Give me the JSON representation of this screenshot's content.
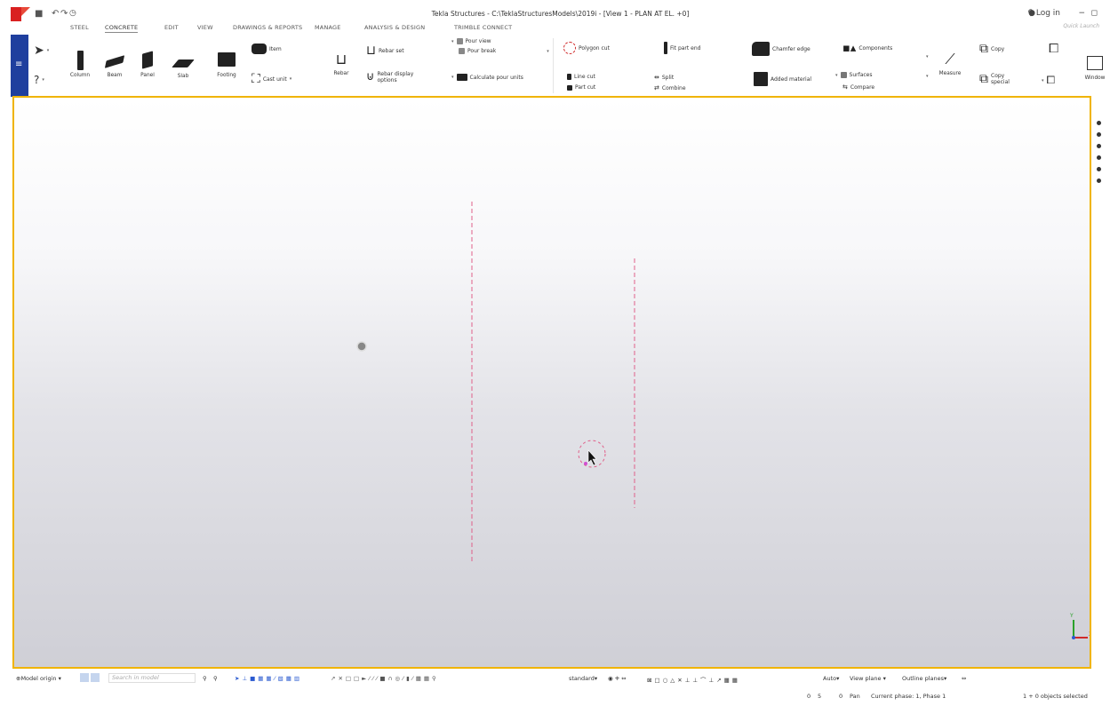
{
  "window": {
    "title": "Tekla Structures - C:\\TeklaStructuresModels\\2019i - [View 1 - PLAN AT EL. +0]",
    "login_label": "Log in",
    "quick_launch_placeholder": "Quick Launch"
  },
  "tabs": [
    "STEEL",
    "CONCRETE",
    "EDIT",
    "VIEW",
    "DRAWINGS & REPORTS",
    "MANAGE",
    "ANALYSIS & DESIGN",
    "TRIMBLE CONNECT"
  ],
  "active_tab": "CONCRETE",
  "ribbon": {
    "column": "Column",
    "beam": "Beam",
    "panel": "Panel",
    "slab": "Slab",
    "footing": "Footing",
    "item": "Item",
    "cast_unit": "Cast unit",
    "rebar": "Rebar",
    "rebar_set": "Rebar set",
    "rebar_display_1": "Rebar display",
    "rebar_display_2": "options",
    "pour_view": "Pour view",
    "pour_break": "Pour break",
    "calculate_pour_units": "Calculate pour units",
    "polygon_cut": "Polygon cut",
    "line_cut": "Line cut",
    "part_cut": "Part cut",
    "fit_part_end": "Fit part end",
    "split": "Split",
    "combine": "Combine",
    "chamfer_edge": "Chamfer edge",
    "added_material": "Added material",
    "components": "Components",
    "surfaces": "Surfaces",
    "compare": "Compare",
    "measure": "Measure",
    "copy": "Copy",
    "copy_special_1": "Copy",
    "copy_special_2": "special",
    "window": "Window"
  },
  "bottom_toolbar": {
    "model_origin": "Model origin",
    "search_placeholder": "Search in model",
    "standard": "standard",
    "auto": "Auto",
    "view_plane": "View plane",
    "outline_planes": "Outline planes"
  },
  "status": {
    "coord_a": "0",
    "coord_b": "5",
    "coord_c": "0",
    "mode": "Pan",
    "phase": "Current phase: 1, Phase 1",
    "selection": "1 + 0 objects selected"
  },
  "colors": {
    "viewport_border": "#f0b400",
    "gridline": "#e0608a",
    "side_strip": "#1f3f9e",
    "axis_y": "#2aa02a",
    "axis_x": "#d02a2a",
    "axis_z": "#2a5ad0"
  }
}
